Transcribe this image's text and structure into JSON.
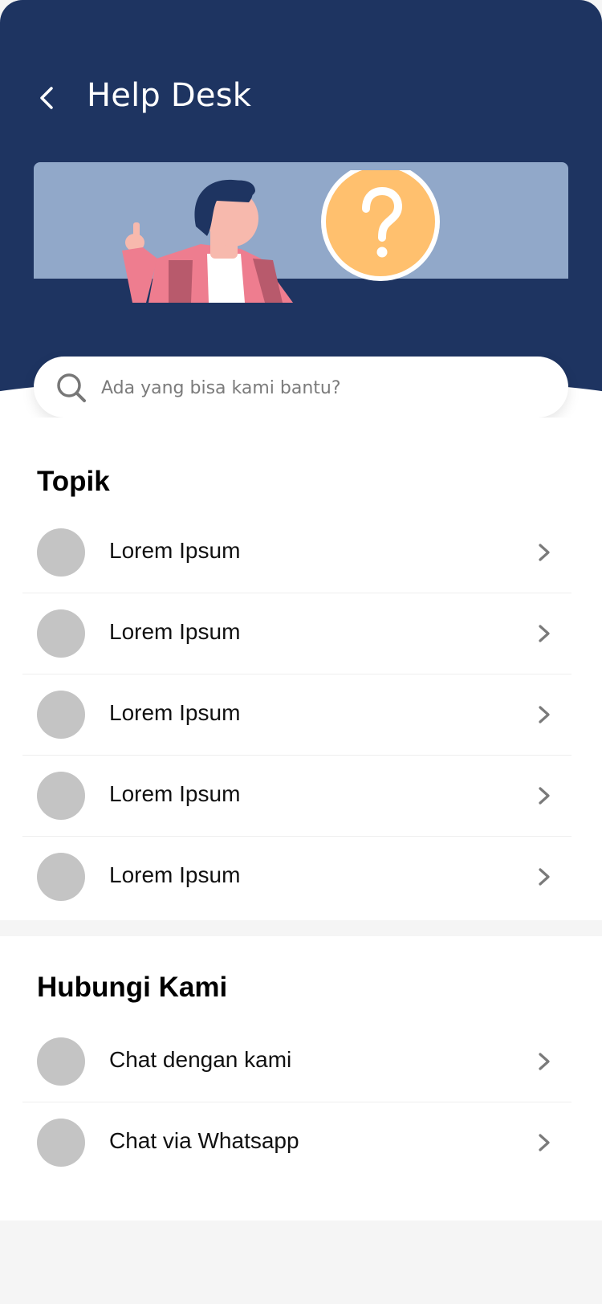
{
  "header": {
    "title": "Help Desk",
    "back_icon": "chevron-left-icon",
    "background_color": "#1e3461"
  },
  "banner": {
    "background_color": "#91a8c9",
    "question_badge_color": "#ffc06e",
    "question_mark": "?"
  },
  "search": {
    "placeholder": "Ada yang bisa kami bantu?",
    "value": "",
    "icon": "search-icon"
  },
  "topics": {
    "title": "Topik",
    "items": [
      {
        "label": "Lorem Ipsum"
      },
      {
        "label": "Lorem Ipsum"
      },
      {
        "label": "Lorem Ipsum"
      },
      {
        "label": "Lorem Ipsum"
      },
      {
        "label": "Lorem Ipsum"
      }
    ]
  },
  "contact": {
    "title": "Hubungi Kami",
    "items": [
      {
        "label": "Chat dengan kami"
      },
      {
        "label": "Chat via Whatsapp"
      }
    ]
  },
  "colors": {
    "avatar_placeholder": "#c4c4c4",
    "chevron": "#7a7a7a",
    "page_background": "#f5f5f5"
  }
}
